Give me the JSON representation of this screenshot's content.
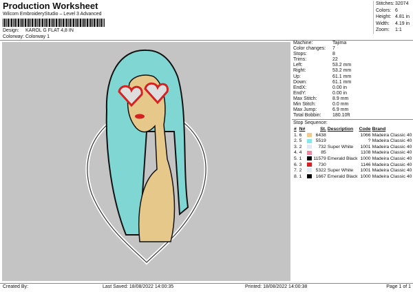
{
  "header": {
    "title": "Production Worksheet",
    "subtitle": "Wilcom EmbroideryStudio – Level 3 Advanced",
    "design_label": "Design:",
    "design": "KAROL G FLAT 4,8 IN",
    "colorway_label": "Colorway:",
    "colorway": "Colorway 1"
  },
  "summary": [
    {
      "label": "Stitches:",
      "value": "32074"
    },
    {
      "label": "Colors:",
      "value": "6"
    },
    {
      "label": "Height:",
      "value": "4.81 in"
    },
    {
      "label": "Width:",
      "value": "4.19 in"
    },
    {
      "label": "Zoom:",
      "value": "1:1"
    }
  ],
  "details": [
    {
      "label": "Machine:",
      "value": "Tajima"
    },
    {
      "label": "Color changes:",
      "value": "7"
    },
    {
      "label": "Stops:",
      "value": "8"
    },
    {
      "label": "Trims:",
      "value": "22"
    },
    {
      "label": "Left:",
      "value": "53.2 mm"
    },
    {
      "label": "Right:",
      "value": "53.2 mm"
    },
    {
      "label": "Up:",
      "value": "61.1 mm"
    },
    {
      "label": "Down:",
      "value": "61.1 mm"
    },
    {
      "label": "EndX:",
      "value": "0.00 in"
    },
    {
      "label": "EndY:",
      "value": "0.00 in"
    },
    {
      "label": "Max Stitch:",
      "value": "8.9 mm"
    },
    {
      "label": "Min Stitch:",
      "value": "0.0 mm"
    },
    {
      "label": "Max Jump:",
      "value": "6.9 mm"
    },
    {
      "label": "Total Bobbin:",
      "value": "180.10ft"
    }
  ],
  "stop_sequence": {
    "title": "Stop Sequence:",
    "headers": [
      "#",
      "N#",
      "St.",
      "Description",
      "Code",
      "Brand"
    ],
    "rows": [
      {
        "n": "1.",
        "needle": "6",
        "color": "#f2c98e",
        "st": "6438",
        "desc": "",
        "code": "1066",
        "brand": "Madeira Classic 40"
      },
      {
        "n": "2.",
        "needle": "5",
        "color": "#86e6ee",
        "st": "5519",
        "desc": "",
        "code": "?",
        "brand": "Madeira Classic 40"
      },
      {
        "n": "3.",
        "needle": "2",
        "color": "#e2e8f6",
        "st": "732",
        "desc": "Super White",
        "code": "1001",
        "brand": "Madeira Classic 40"
      },
      {
        "n": "4.",
        "needle": "4",
        "color": "#ee86a0",
        "st": "85",
        "desc": "",
        "code": "1108",
        "brand": "Madeira Classic 40"
      },
      {
        "n": "5.",
        "needle": "1",
        "color": "#000000",
        "st": "11579",
        "desc": "Emerald Black",
        "code": "1000",
        "brand": "Madeira Classic 40"
      },
      {
        "n": "6.",
        "needle": "3",
        "color": "#d42222",
        "st": "730",
        "desc": "",
        "code": "1146",
        "brand": "Madeira Classic 40"
      },
      {
        "n": "7.",
        "needle": "2",
        "color": "#e2e8f6",
        "st": "5322",
        "desc": "Super White",
        "code": "1001",
        "brand": "Madeira Classic 40"
      },
      {
        "n": "8.",
        "needle": "1",
        "color": "#000000",
        "st": "1667",
        "desc": "Emerald Black",
        "code": "1000",
        "brand": "Madeira Classic 40"
      }
    ]
  },
  "footer": {
    "created": "Created By:",
    "saved": "Last Saved: 18/08/2022 14:00:35",
    "printed": "Printed: 18/08/2022 14:00:38",
    "page": "Page 1 of 1"
  }
}
